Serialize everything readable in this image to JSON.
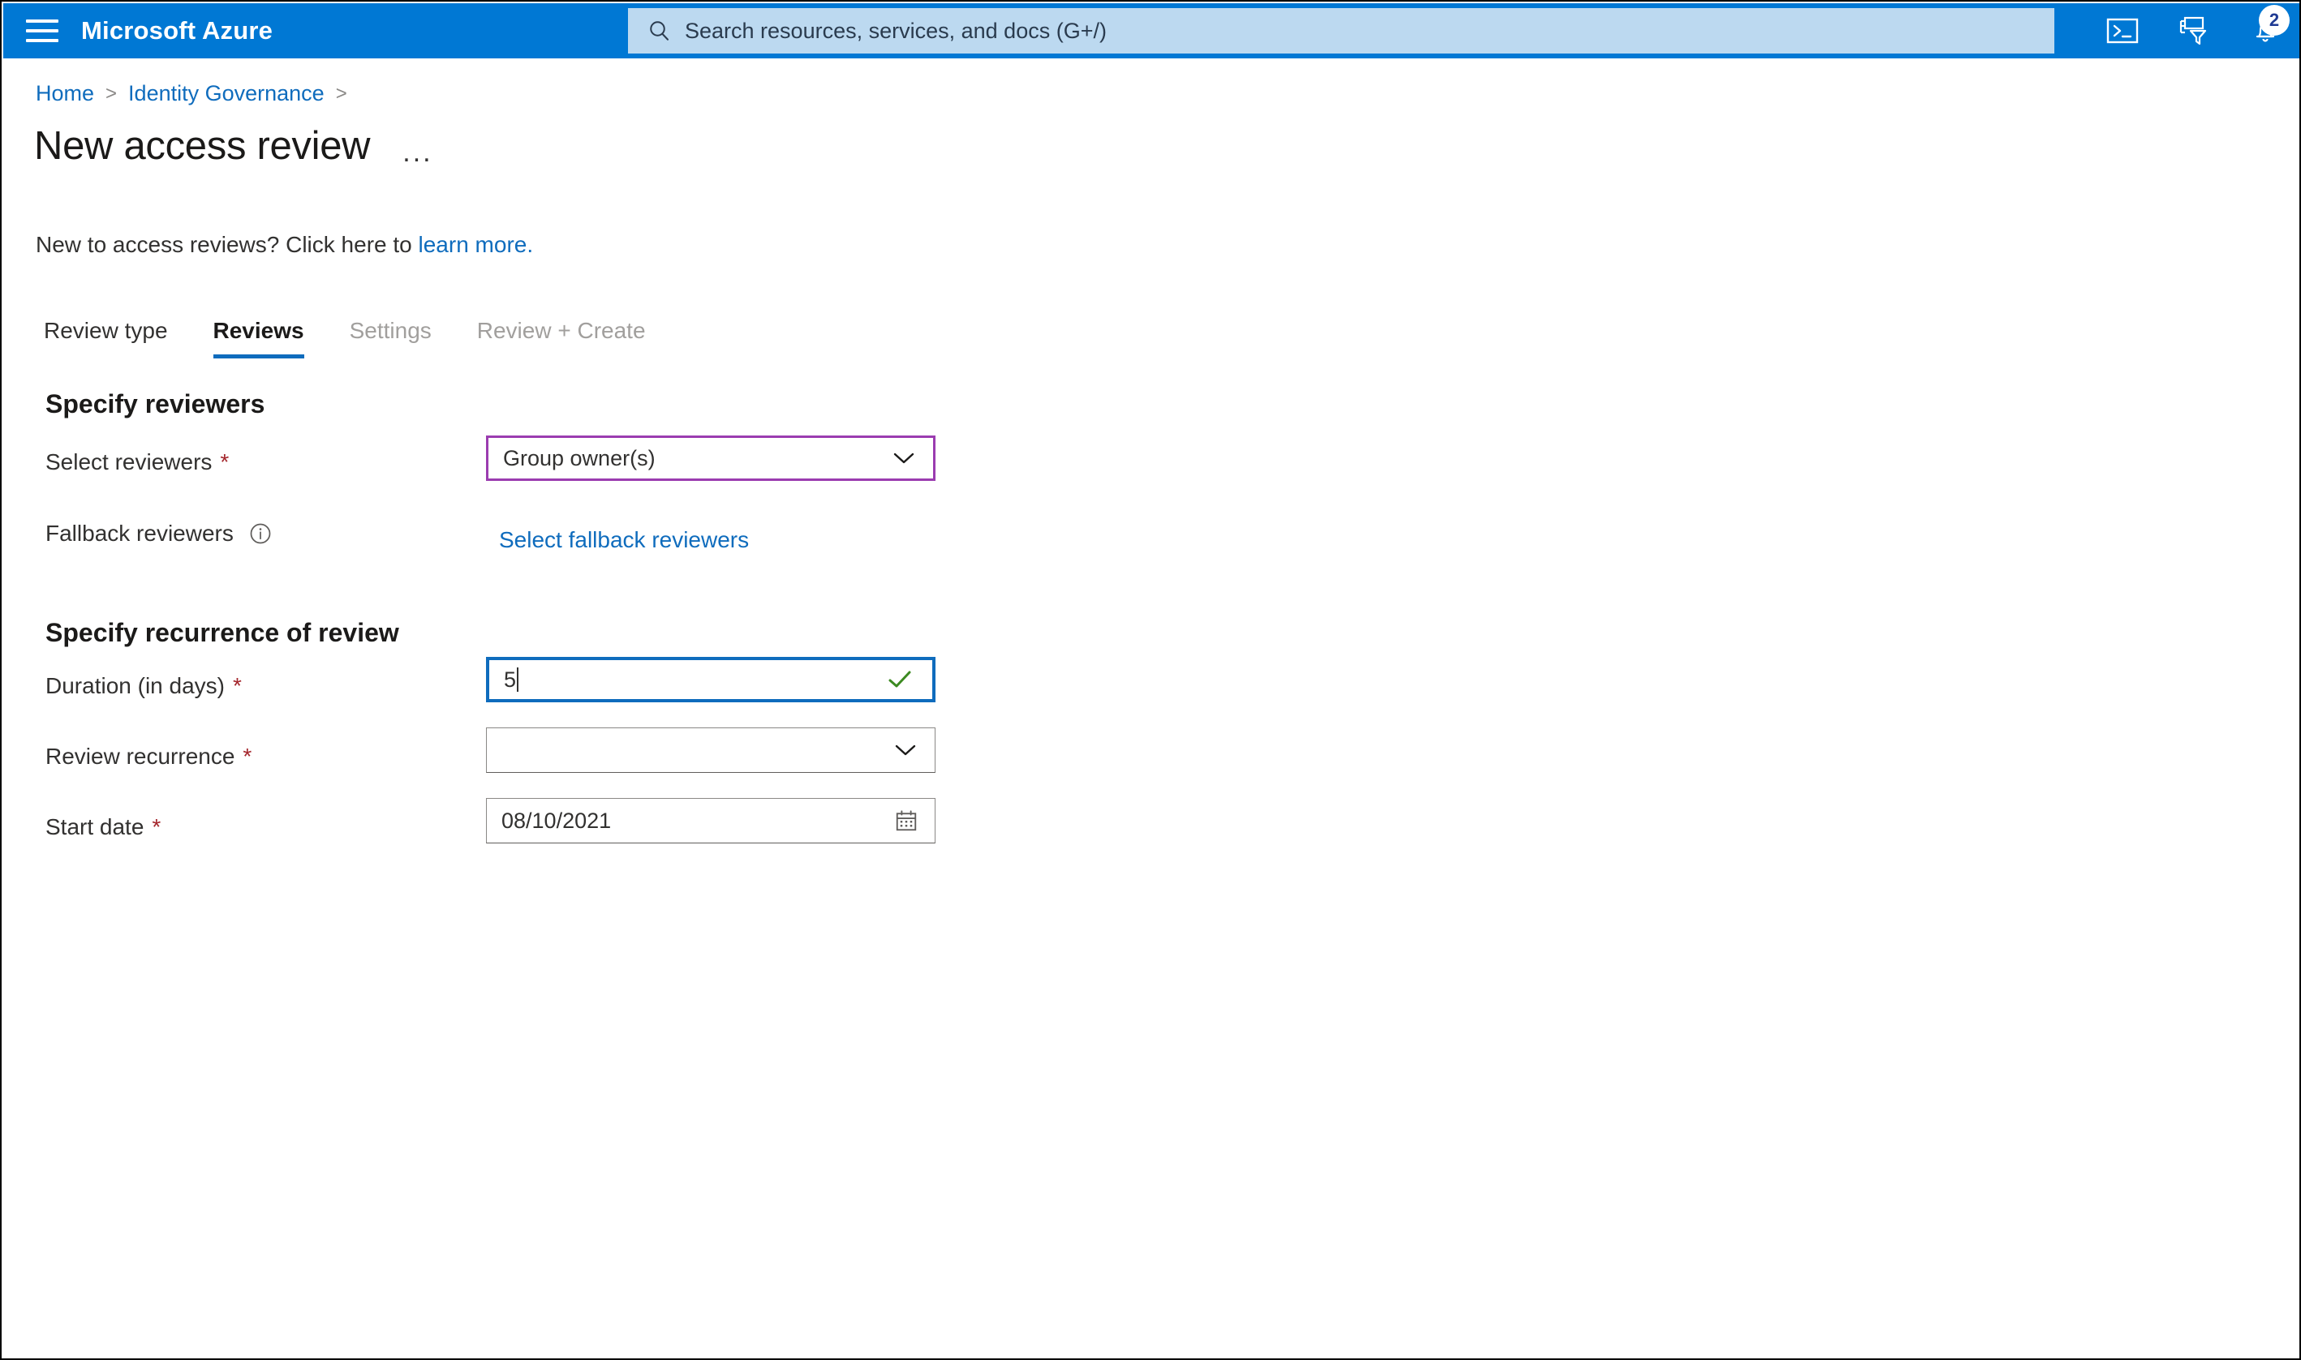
{
  "topbar": {
    "menu_icon": "hamburger-menu-icon",
    "brand": "Microsoft Azure",
    "search_placeholder": "Search resources, services, and docs (G+/)",
    "search_value": "",
    "icons": [
      {
        "name": "cloud-shell-icon",
        "label": "Cloud Shell"
      },
      {
        "name": "directory-filter-icon",
        "label": "Directories + subscriptions"
      },
      {
        "name": "notifications-bell-icon",
        "label": "Notifications"
      }
    ],
    "notification_count": "2",
    "accent_color": "#0078d4",
    "search_bg": "#bcd9f0"
  },
  "breadcrumb": {
    "items": [
      {
        "label": "Home",
        "link": true
      },
      {
        "label": "Identity Governance",
        "link": true
      }
    ],
    "separator": ">",
    "trailing_separator": ">"
  },
  "header": {
    "title": "New access review",
    "more_actions": "..."
  },
  "intro": {
    "text_before": "New to access reviews? Click here to ",
    "link_text": "learn more."
  },
  "tabs": [
    {
      "label": "Review type",
      "state": "enabled"
    },
    {
      "label": "Reviews",
      "state": "active"
    },
    {
      "label": "Settings",
      "state": "disabled"
    },
    {
      "label": "Review + Create",
      "state": "disabled"
    }
  ],
  "sections": [
    {
      "title": "Specify reviewers",
      "fields": [
        {
          "label": "Select reviewers",
          "required": true,
          "control": "dropdown",
          "value": "Group owner(s)",
          "focus": "purple"
        },
        {
          "label": "Fallback reviewers",
          "required": false,
          "info": true,
          "control": "link",
          "value": "Select fallback reviewers"
        }
      ]
    },
    {
      "title": "Specify recurrence of review",
      "fields": [
        {
          "label": "Duration (in days)",
          "required": true,
          "control": "textbox",
          "value": "5",
          "focus": "blue",
          "validation": "valid"
        },
        {
          "label": "Review recurrence",
          "required": true,
          "control": "dropdown",
          "value": ""
        },
        {
          "label": "Start date",
          "required": true,
          "control": "datepicker",
          "value": "08/10/2021"
        }
      ]
    }
  ],
  "colors": {
    "azure_blue": "#0078d4",
    "link_blue": "#0f6cbd",
    "required_red": "#a4262c",
    "focus_purple": "#9b3cb0",
    "valid_green": "#3c8a21"
  },
  "required_marker": "*"
}
